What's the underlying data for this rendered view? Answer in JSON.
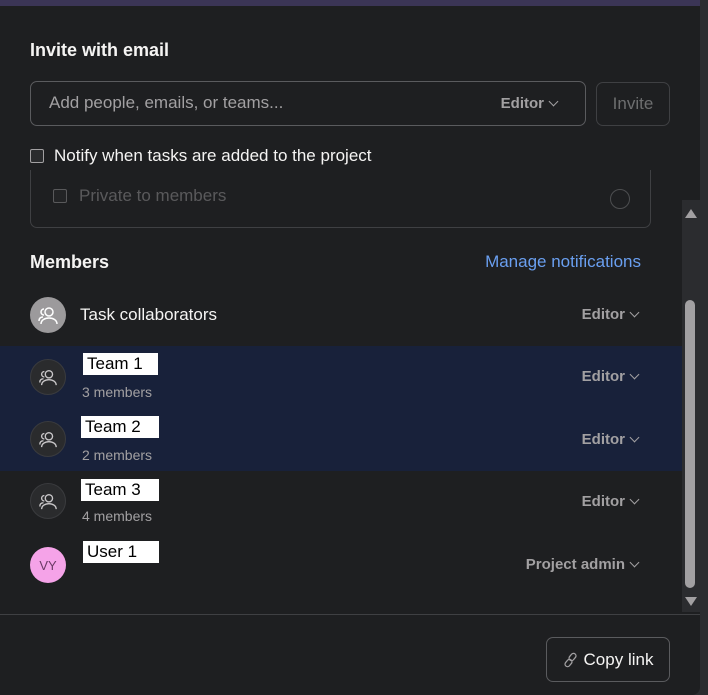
{
  "invite": {
    "title": "Invite with email",
    "placeholder": "Add people, emails, or teams...",
    "role": "Editor",
    "button": "Invite",
    "notify_label": "Notify when tasks are added to the project"
  },
  "privacy": {
    "label": "Private to members"
  },
  "members": {
    "title": "Members",
    "manage_link": "Manage notifications",
    "items": [
      {
        "name": "Task collaborators",
        "role": "Editor"
      },
      {
        "name": "Team 1",
        "sub": "3 members",
        "role": "Editor"
      },
      {
        "name": "Team 2",
        "sub": "2 members",
        "role": "Editor"
      },
      {
        "name": "Team 3",
        "sub": "4 members",
        "role": "Editor"
      },
      {
        "name": "User 1",
        "initials": "VY",
        "role": "Project admin"
      }
    ]
  },
  "footer": {
    "copy_link": "Copy link"
  },
  "colors": {
    "link": "#6a9ff0",
    "selected_row": "#18213a",
    "user_avatar": "#f5a3e8"
  }
}
